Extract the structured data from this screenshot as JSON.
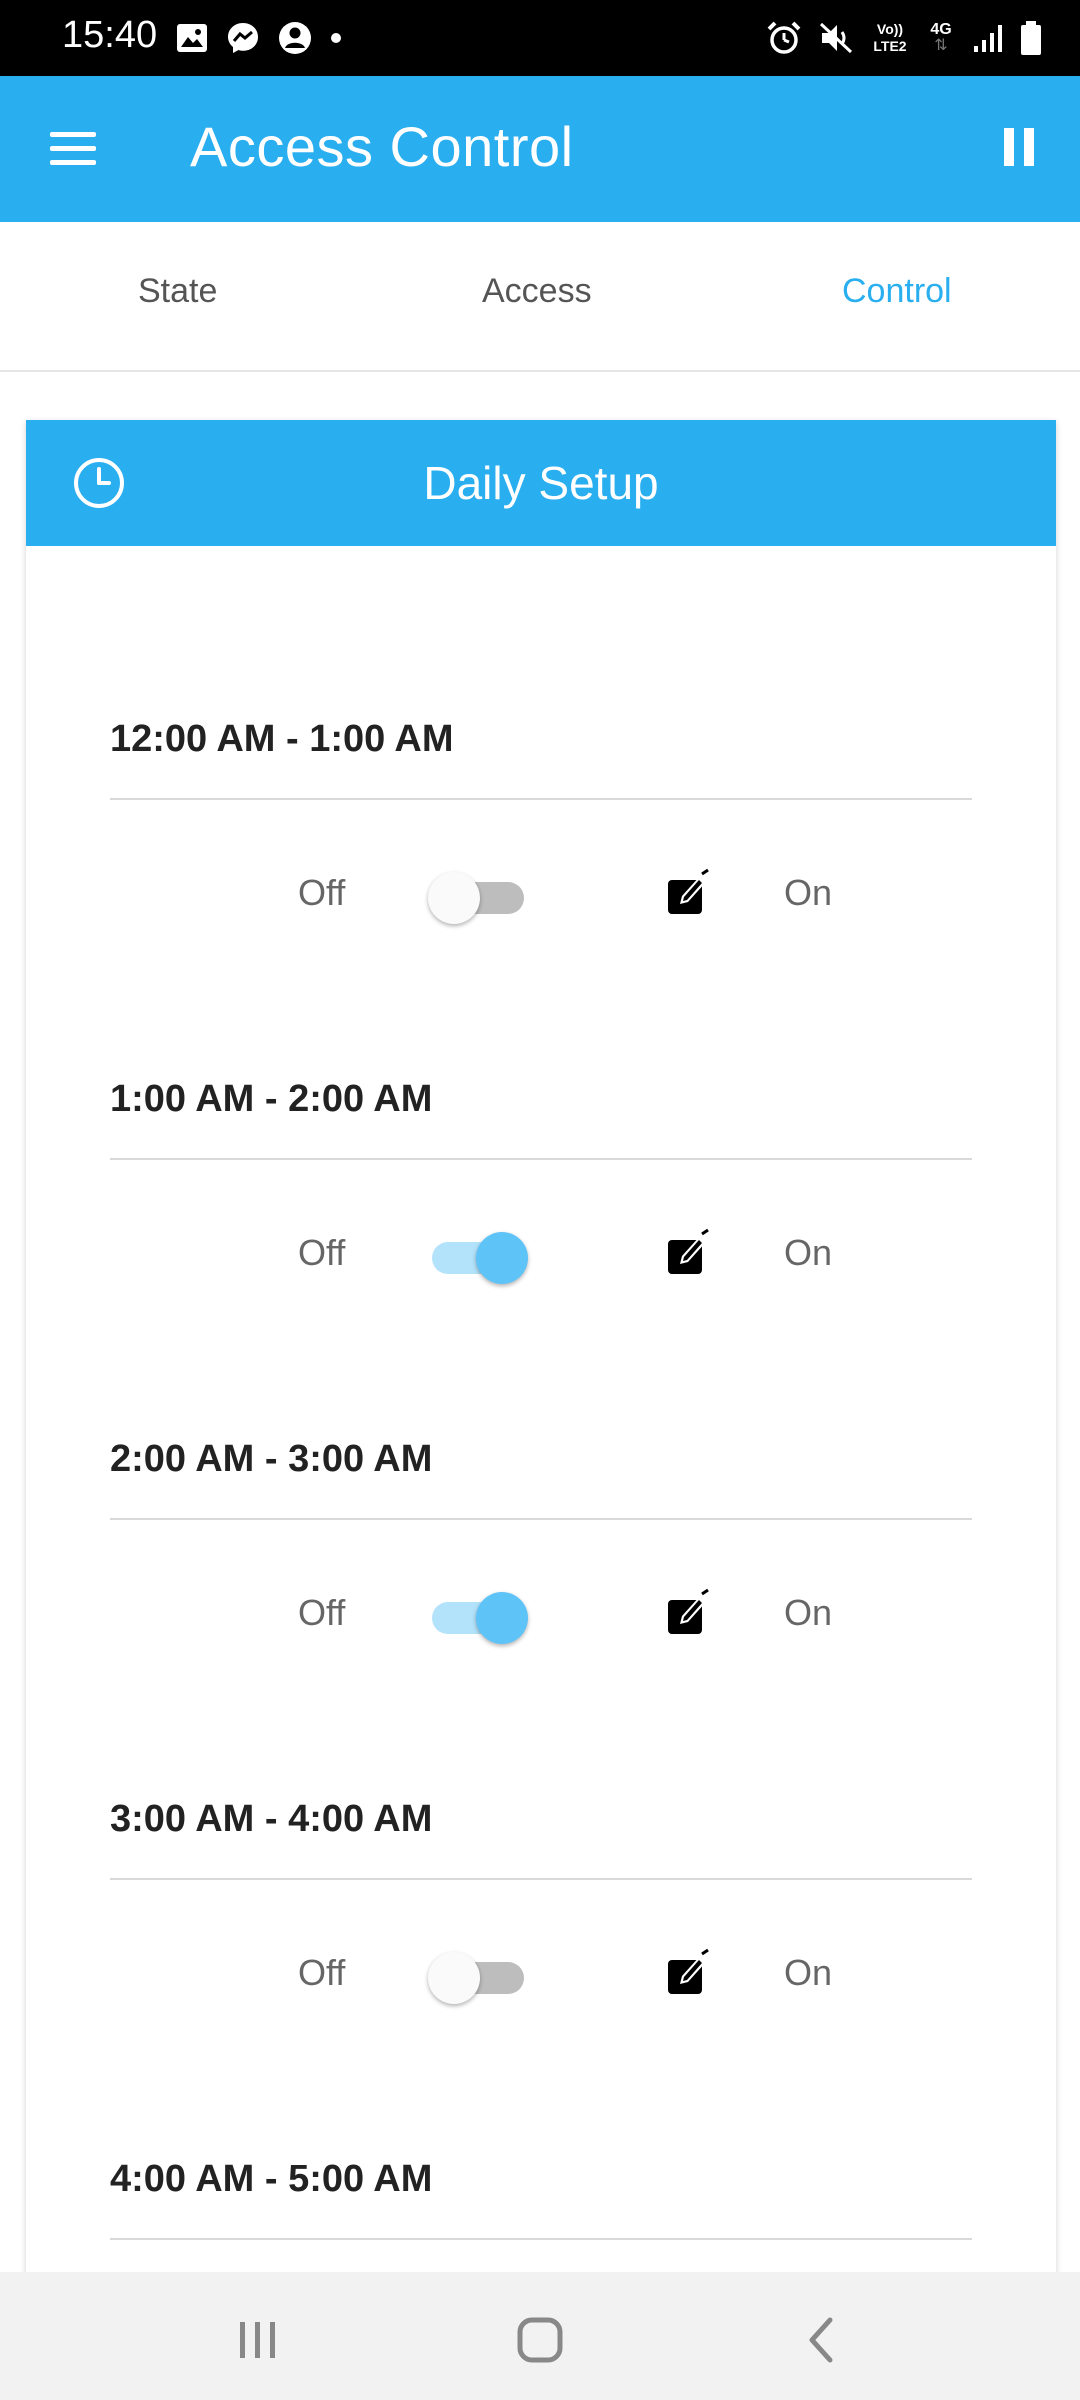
{
  "status_bar": {
    "time": "15:40",
    "network_volte": "Vo)) LTE2",
    "network_type": "4G",
    "icons_left": [
      "gallery-icon",
      "messenger-icon",
      "account-icon",
      "dot-icon"
    ],
    "icons_right": [
      "alarm-icon",
      "mute-icon",
      "volte-icon",
      "data-icon",
      "signal-icon",
      "battery-icon"
    ]
  },
  "app_bar": {
    "title": "Access Control",
    "menu_icon": "menu-icon",
    "action_icon": "pause-icon"
  },
  "tabs": [
    {
      "label": "State",
      "active": false
    },
    {
      "label": "Access",
      "active": false
    },
    {
      "label": "Control",
      "active": true
    }
  ],
  "card": {
    "title": "Daily Setup",
    "icon": "clock-icon",
    "slots": [
      {
        "title": "12:00 AM - 1:00 AM",
        "off_label": "Off",
        "on_label": "On",
        "enabled": false
      },
      {
        "title": "1:00 AM - 2:00 AM",
        "off_label": "Off",
        "on_label": "On",
        "enabled": true
      },
      {
        "title": "2:00 AM - 3:00 AM",
        "off_label": "Off",
        "on_label": "On",
        "enabled": true
      },
      {
        "title": "3:00 AM - 4:00 AM",
        "off_label": "Off",
        "on_label": "On",
        "enabled": false
      },
      {
        "title": "4:00 AM - 5:00 AM"
      }
    ]
  },
  "colors": {
    "primary": "#29aef0",
    "toggle_on_thumb": "#5ec3f7",
    "toggle_on_track": "#b3e2fb",
    "toggle_off_track": "#bdbdbd",
    "text_dark": "#222222",
    "text_muted": "#666666"
  },
  "nav_bar": {
    "buttons": [
      "recents-icon",
      "home-icon",
      "back-icon"
    ]
  }
}
